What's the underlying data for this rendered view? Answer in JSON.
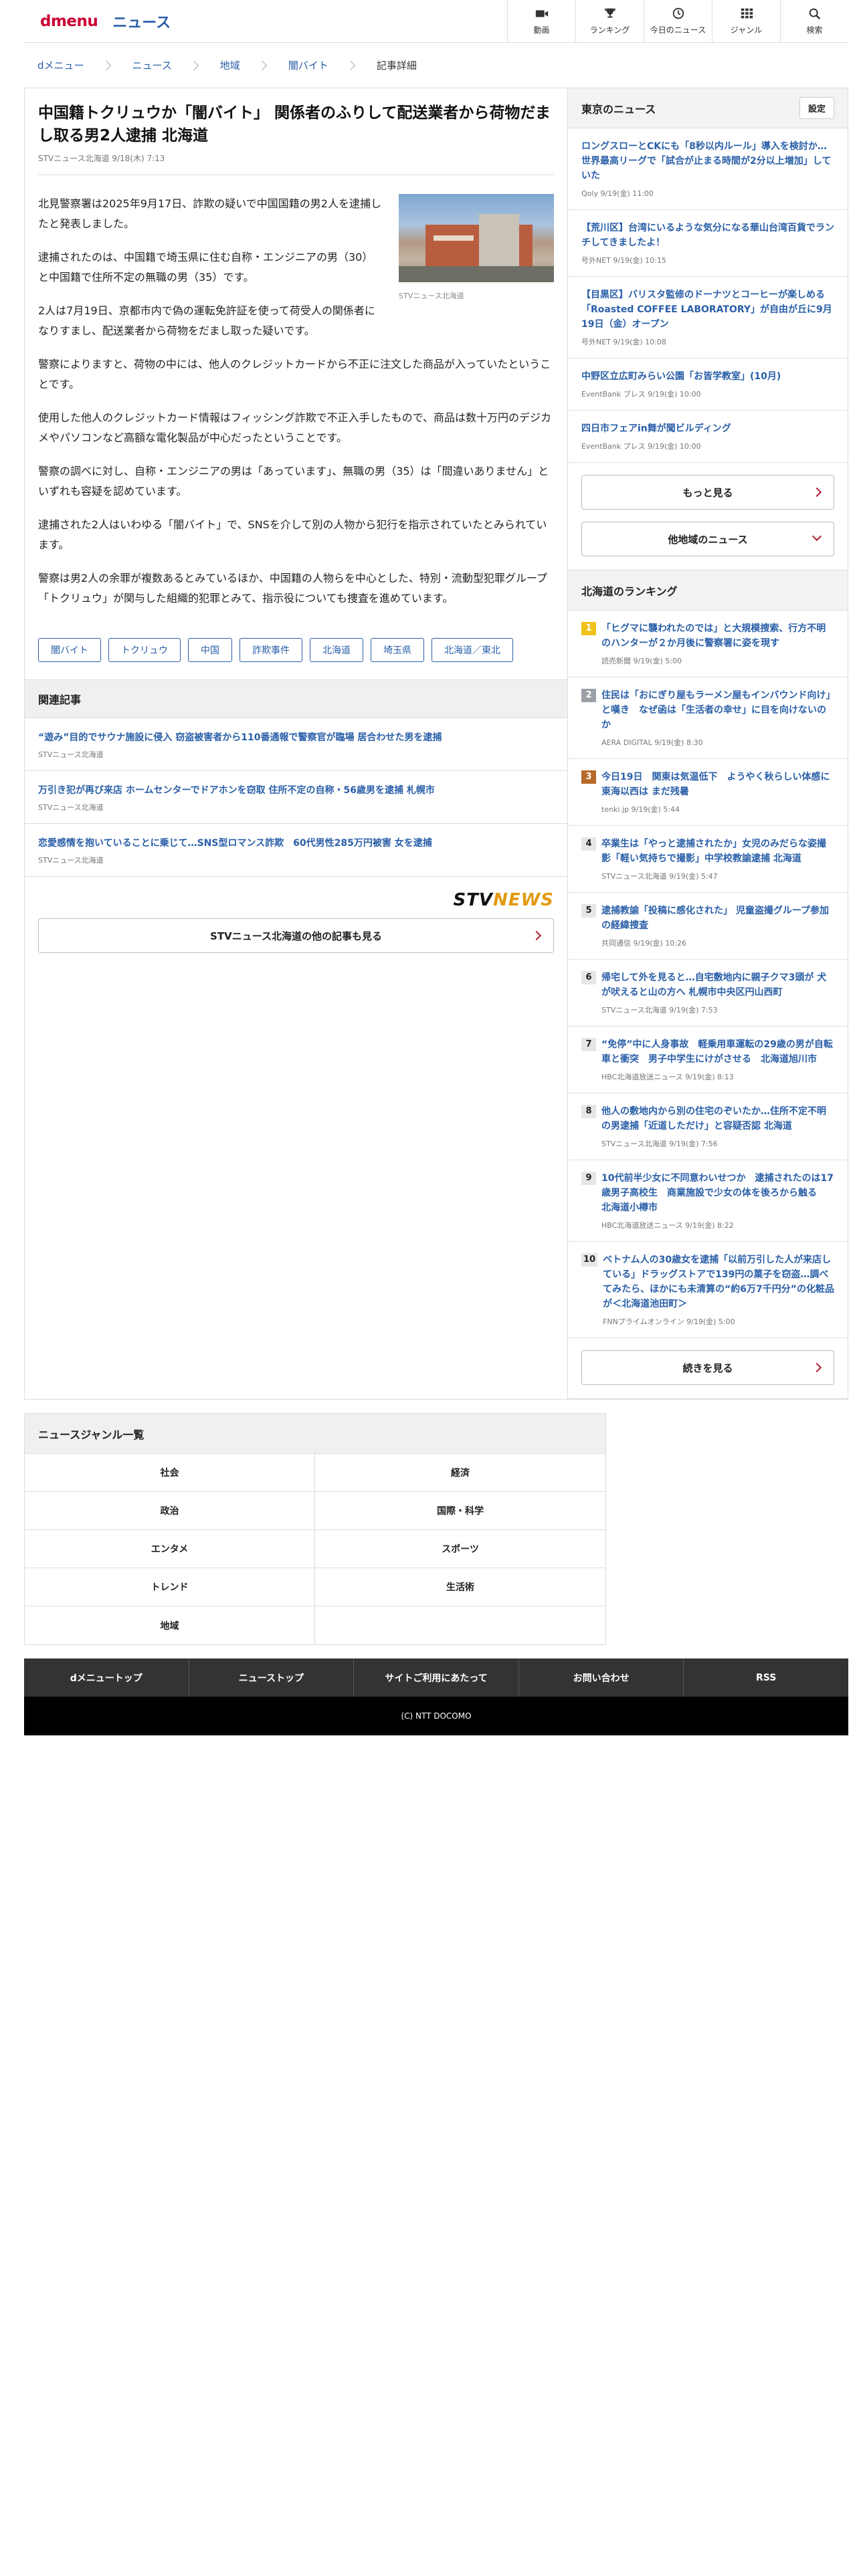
{
  "header": {
    "logo_dmenu": "dmenu",
    "logo_news": "ニュース",
    "nav": [
      {
        "label": "動画",
        "icon": "video-icon"
      },
      {
        "label": "ランキング",
        "icon": "trophy-icon"
      },
      {
        "label": "今日のニュース",
        "icon": "clock-icon"
      },
      {
        "label": "ジャンル",
        "icon": "grid-icon"
      },
      {
        "label": "検索",
        "icon": "search-icon"
      }
    ]
  },
  "breadcrumb": [
    "dメニュー",
    "ニュース",
    "地域",
    "闇バイト",
    "記事詳細"
  ],
  "article": {
    "title": "中国籍トクリュウか「闇バイト」 関係者のふりして配送業者から荷物だまし取る男2人逮捕 北海道",
    "meta": "STVニュース北海道 9/18(木) 7:13",
    "image_caption": "STVニュース北海道",
    "paragraphs": [
      "北見警察署は2025年9月17日、詐欺の疑いで中国国籍の男2人を逮捕したと発表しました。",
      "逮捕されたのは、中国籍で埼玉県に住む自称・エンジニアの男（30）と中国籍で住所不定の無職の男（35）です。",
      "2人は7月19日、京都市内で偽の運転免許証を使って荷受人の関係者になりすまし、配送業者から荷物をだまし取った疑いです。",
      "警察によりますと、荷物の中には、他人のクレジットカードから不正に注文した商品が入っていたということです。",
      "使用した他人のクレジットカード情報はフィッシング詐欺で不正入手したもので、商品は数十万円のデジカメやパソコンなど高額な電化製品が中心だったということです。",
      "警察の調べに対し、自称・エンジニアの男は「あっています」、無職の男（35）は「間違いありません」といずれも容疑を認めています。",
      "逮捕された2人はいわゆる「闇バイト」で、SNSを介して別の人物から犯行を指示されていたとみられています。",
      "警察は男2人の余罪が複数あるとみているほか、中国籍の人物らを中心とした、特別・流動型犯罪グループ「トクリュウ」が関与した組織的犯罪とみて、指示役についても捜査を進めています。"
    ],
    "tags": [
      "闇バイト",
      "トクリュウ",
      "中国",
      "詐欺事件",
      "北海道",
      "埼玉県",
      "北海道／東北"
    ]
  },
  "related": {
    "heading": "関連記事",
    "items": [
      {
        "title": "“遊み”目的でサウナ施設に侵入 窃盗被害者から110番通報で警察官が臨場 居合わせた男を逮捕",
        "source": "STVニュース北海道"
      },
      {
        "title": "万引き犯が再び来店 ホームセンターでドアホンを窃取 住所不定の自称・56歳男を逮捕 札幌市",
        "source": "STVニュース北海道"
      },
      {
        "title": "恋愛感情を抱いていることに乗じて…SNS型ロマンス詐欺　60代男性285万円被害 女を逮捕",
        "source": "STVニュース北海道"
      }
    ],
    "stv_logo_a": "STV",
    "stv_logo_b": "NEWS",
    "more_label": "STVニュース北海道の他の記事も見る"
  },
  "sidebar": {
    "tokyo_heading": "東京のニュース",
    "settings_label": "設定",
    "tokyo_items": [
      {
        "title": "ロングスローとCKにも「8秒以内ルール」導入を検討か…世界最高リーグで「試合が止まる時間が2分以上増加」していた",
        "meta": "Qoly 9/19(金) 11:00"
      },
      {
        "title": "【荒川区】台湾にいるような気分になる華山台湾百貨でランチしてきましたよ！",
        "meta": "号外NET 9/19(金) 10:15"
      },
      {
        "title": "【目黒区】バリスタ監修のドーナツとコーヒーが楽しめる「Roasted COFFEE LABORATORY」が自由が丘に9月19日（金）オープン",
        "meta": "号外NET 9/19(金) 10:08"
      },
      {
        "title": "中野区立広町みらい公園「お皆学教室」(10月)",
        "meta": "EventBank プレス 9/19(金) 10:00"
      },
      {
        "title": "四日市フェアin舞が聞ビルディング",
        "meta": "EventBank プレス 9/19(金) 10:00"
      }
    ],
    "more_label": "もっと見る",
    "other_region_label": "他地域のニュース",
    "ranking_heading": "北海道のランキング",
    "ranking": [
      {
        "rank": "1",
        "title": "「ヒグマに襲われたのでは」と大規模捜索、行方不明のハンターが２か月後に警察署に姿を現す",
        "meta": "読売新聞 9/19(金) 5:00"
      },
      {
        "rank": "2",
        "title": "住民は「おにぎり屋もラーメン屋もインバウンド向け」と嘆き　なぜ函は「生活者の幸せ」に目を向けないのか",
        "meta": "AERA DIGITAL 9/19(金) 8:30"
      },
      {
        "rank": "3",
        "title": "今日19日　関東は気温低下　ようやく秋らしい体感に　東海以西は まだ残暑",
        "meta": "tenki.jp 9/19(金) 5:44"
      },
      {
        "rank": "4",
        "title": "卒業生は「やっと逮捕されたか」女児のみだらな姿撮影「軽い気持ちで撮影」中学校教諭逮捕 北海道",
        "meta": "STVニュース北海道 9/19(金) 5:47"
      },
      {
        "rank": "5",
        "title": "逮捕教諭「投稿に感化された」 児童盗撮グループ参加の経緯捜査",
        "meta": "共同通信 9/19(金) 10:26"
      },
      {
        "rank": "6",
        "title": "帰宅して外を見ると…自宅敷地内に親子クマ3頭が 犬が吠えると山の方へ 札幌市中央区円山西町",
        "meta": "STVニュース北海道 9/19(金) 7:53"
      },
      {
        "rank": "7",
        "title": "“免停”中に人身事故　軽乗用車運転の29歳の男が自転車と衝突　男子中学生にけがさせる　北海道旭川市",
        "meta": "HBC北海道放送ニュース 9/19(金) 8:13"
      },
      {
        "rank": "8",
        "title": "他人の敷地内から別の住宅のぞいたか…住所不定不明の男逮捕「近道しただけ」と容疑否認 北海道",
        "meta": "STVニュース北海道 9/19(金) 7:56"
      },
      {
        "rank": "9",
        "title": "10代前半少女に不同意わいせつか　逮捕されたのは17歳男子高校生　商業施設で少女の体を後ろから触る　北海道小樽市",
        "meta": "HBC北海道放送ニュース 9/19(金) 8:22"
      },
      {
        "rank": "10",
        "title": "ベトナム人の30歳女を逮捕「以前万引した人が来店している」ドラッグストアで139円の菓子を窃盗…調べてみたら、ほかにも未清算の“約6万7千円分”の化粧品が＜北海道池田町＞",
        "meta": "FNNプライムオンライン 9/19(金) 5:00"
      }
    ],
    "continue_label": "続きを見る"
  },
  "genre": {
    "heading": "ニュースジャンル一覧",
    "items": [
      "社会",
      "経済",
      "政治",
      "国際・科学",
      "エンタメ",
      "スポーツ",
      "トレンド",
      "生活術",
      "地域",
      ""
    ]
  },
  "footer": {
    "nav": [
      "dメニュートップ",
      "ニューストップ",
      "サイトご利用にあたって",
      "お問い合わせ",
      "RSS"
    ],
    "copyright": "(C) NTT DOCOMO"
  },
  "colors": {
    "brand_red": "#cc0033",
    "link_blue": "#2a5fa8",
    "stv_orange": "#e39a12"
  }
}
